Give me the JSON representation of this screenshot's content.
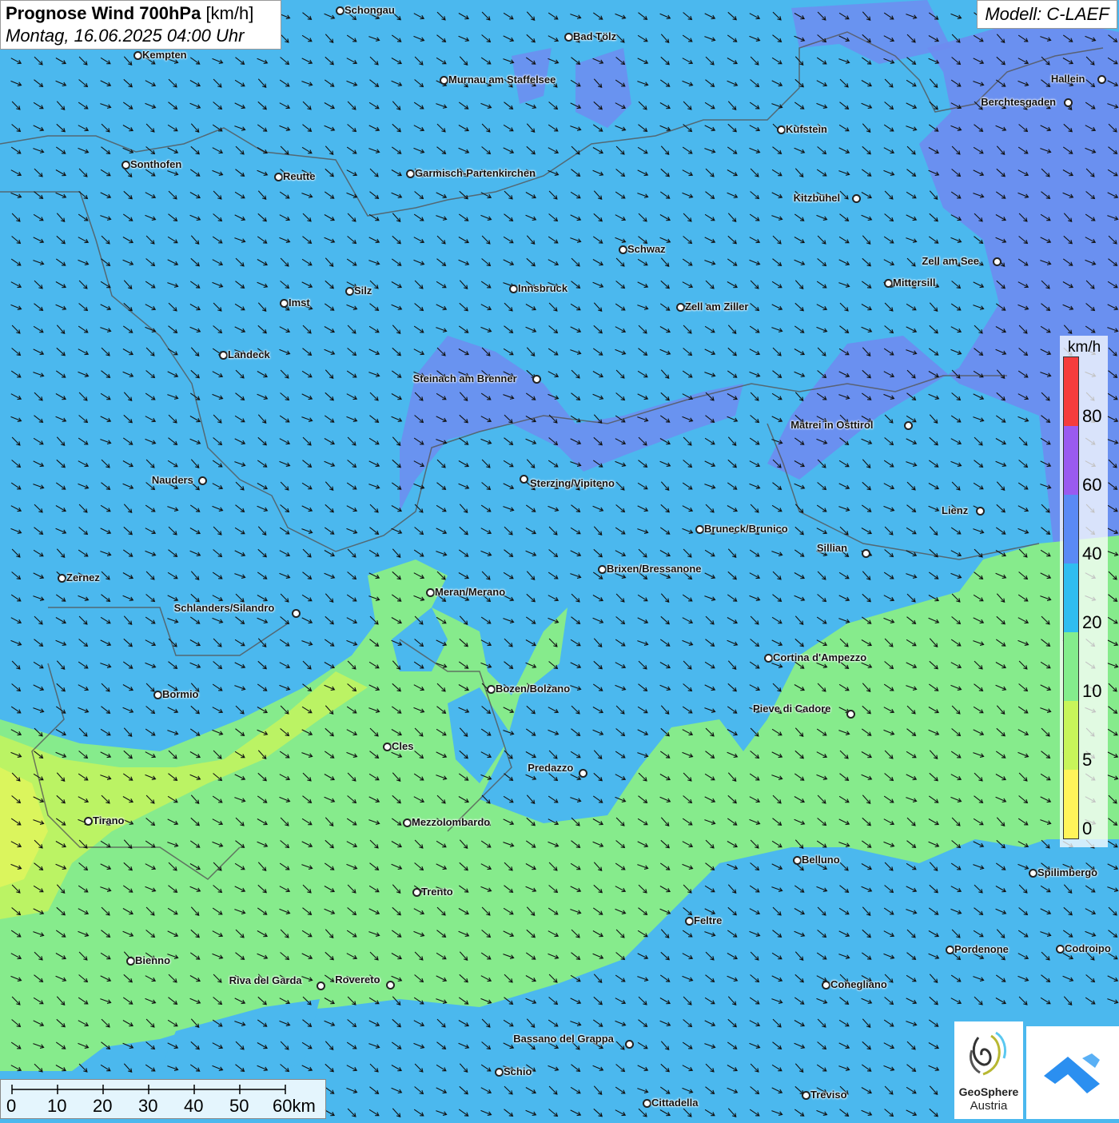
{
  "header": {
    "title_bold": "Prognose Wind 700hPa",
    "title_unit": "[km/h]",
    "datetime": "Montag, 16.06.2025 04:00 Uhr",
    "model": "Modell: C-LAEF"
  },
  "legend": {
    "unit": "km/h",
    "classes": [
      {
        "color": "#fff45a"
      },
      {
        "color": "#c8f55a"
      },
      {
        "color": "#84ed8c"
      },
      {
        "color": "#2fbdf0"
      },
      {
        "color": "#5a8af5"
      },
      {
        "color": "#9a5af0"
      },
      {
        "color": "#f53c3c"
      }
    ],
    "labels": [
      "0",
      "5",
      "10",
      "20",
      "40",
      "60",
      "80"
    ]
  },
  "scale": {
    "labels": [
      "0",
      "10",
      "20",
      "30",
      "40",
      "50",
      "60km"
    ]
  },
  "logos": {
    "geosphere_name": "GeoSphere",
    "geosphere_sub": "Austria"
  },
  "cities": [
    {
      "name": "Schongau"
    },
    {
      "name": "Bad Tölz"
    },
    {
      "name": "Kempten"
    },
    {
      "name": "Murnau am Staffelsee"
    },
    {
      "name": "Hallein"
    },
    {
      "name": "Berchtesgaden"
    },
    {
      "name": "Kufstein"
    },
    {
      "name": "Sonthofen"
    },
    {
      "name": "Reutte"
    },
    {
      "name": "Garmisch-Partenkirchen"
    },
    {
      "name": "Kitzbühel"
    },
    {
      "name": "Schwaz"
    },
    {
      "name": "Zell am See"
    },
    {
      "name": "Mittersill"
    },
    {
      "name": "Innsbruck"
    },
    {
      "name": "Silz"
    },
    {
      "name": "Imst"
    },
    {
      "name": "Zell am Ziller"
    },
    {
      "name": "Landeck"
    },
    {
      "name": "Steinach am Brenner"
    },
    {
      "name": "Matrei in Osttirol"
    },
    {
      "name": "Nauders"
    },
    {
      "name": "Sterzing/Vipiteno"
    },
    {
      "name": "Lienz"
    },
    {
      "name": "Bruneck/Brunico"
    },
    {
      "name": "Sillian"
    },
    {
      "name": "Zernez"
    },
    {
      "name": "Brixen/Bressanone"
    },
    {
      "name": "Meran/Merano"
    },
    {
      "name": "Schlanders/Silandro"
    },
    {
      "name": "Cortina d'Ampezzo"
    },
    {
      "name": "Bozen/Bolzano"
    },
    {
      "name": "Bormio"
    },
    {
      "name": "Pieve di Cadore"
    },
    {
      "name": "Cles"
    },
    {
      "name": "Predazzo"
    },
    {
      "name": "Tirano"
    },
    {
      "name": "Mezzolombardo"
    },
    {
      "name": "Belluno"
    },
    {
      "name": "Spilimbergo"
    },
    {
      "name": "Trento"
    },
    {
      "name": "Feltre"
    },
    {
      "name": "Bienno"
    },
    {
      "name": "Pordenone"
    },
    {
      "name": "Codroipo"
    },
    {
      "name": "Riva del Garda"
    },
    {
      "name": "Rovereto"
    },
    {
      "name": "Conegliano"
    },
    {
      "name": "Bassano del Grappa"
    },
    {
      "name": "Schio"
    },
    {
      "name": "Treviso"
    },
    {
      "name": "Cittadella"
    }
  ]
}
